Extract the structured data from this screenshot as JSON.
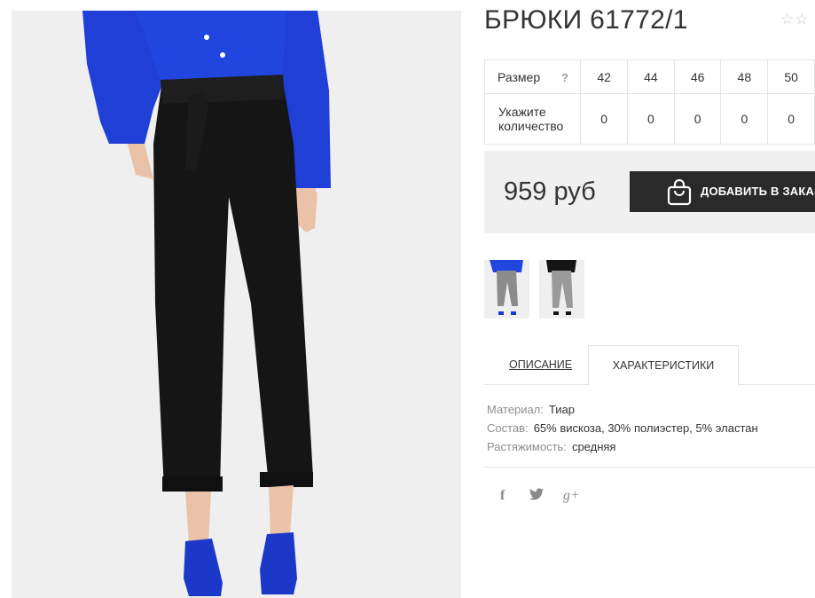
{
  "product": {
    "title": "БРЮКИ 61772/1",
    "rating_stars": "☆☆"
  },
  "size_table": {
    "size_label": "Размер",
    "help": "?",
    "qty_label": "Укажите количество",
    "sizes": [
      "42",
      "44",
      "46",
      "48",
      "50"
    ],
    "quantities": [
      "0",
      "0",
      "0",
      "0",
      "0"
    ]
  },
  "price": {
    "value": "959 руб"
  },
  "buy": {
    "label": "ДОБАВИТЬ В ЗАКАЗ",
    "icon": "shopping-bag-icon"
  },
  "tabs": {
    "description": "ОПИСАНИЕ",
    "characteristics": "ХАРАКТЕРИСТИКИ",
    "active": "characteristics"
  },
  "specs": [
    {
      "key": "Материал:",
      "value": "Тиар"
    },
    {
      "key": "Состав:",
      "value": "65% вискоза, 30% полиэстер, 5% эластан"
    },
    {
      "key": "Растяжимость:",
      "value": "средняя"
    }
  ],
  "social": {
    "facebook": "f",
    "twitter": "🐦",
    "googleplus": "g+"
  },
  "colors": {
    "blouse": "#1f3fd6",
    "pants": "#151515",
    "button": "#2a2a2a",
    "panel": "#f0f0f0"
  }
}
